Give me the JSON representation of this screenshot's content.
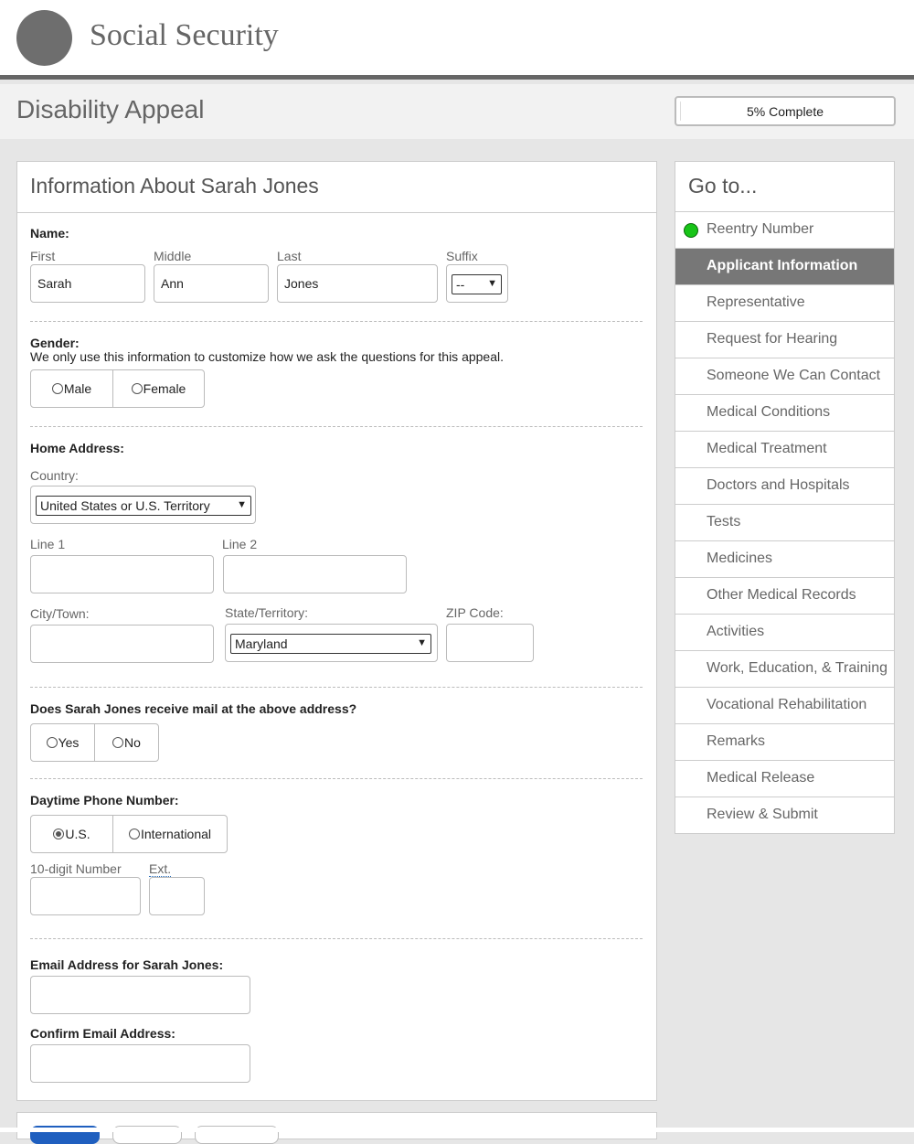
{
  "header": {
    "site_title": "Social Security"
  },
  "title_bar": {
    "page_title": "Disability Appeal",
    "progress_text": "5% Complete",
    "progress_percent": 5
  },
  "form": {
    "title": "Information About Sarah Jones",
    "name": {
      "label": "Name:",
      "first_label": "First",
      "first_value": "Sarah",
      "middle_label": "Middle",
      "middle_value": "Ann",
      "last_label": "Last",
      "last_value": "Jones",
      "suffix_label": "Suffix",
      "suffix_value": "--"
    },
    "gender": {
      "label": "Gender:",
      "help": "We only use this information to customize how we ask the questions for this appeal.",
      "options": [
        "Male",
        "Female"
      ]
    },
    "address": {
      "label": "Home Address:",
      "country_label": "Country:",
      "country_value": "United States or U.S. Territory",
      "line1_label": "Line 1",
      "line2_label": "Line 2",
      "city_label": "City/Town:",
      "state_label": "State/Territory:",
      "state_value": "Maryland",
      "zip_label": "ZIP Code:"
    },
    "mail": {
      "label": "Does Sarah Jones receive mail at the above address?",
      "options": [
        "Yes",
        "No"
      ]
    },
    "phone": {
      "label": "Daytime Phone Number:",
      "options": [
        "U.S.",
        "International"
      ],
      "selected": "U.S.",
      "number_label": "10-digit Number",
      "ext_label": "Ext."
    },
    "email": {
      "label": "Email Address for Sarah Jones:",
      "confirm_label": "Confirm Email Address:"
    }
  },
  "sidebar": {
    "title": "Go to...",
    "items": [
      {
        "label": "Reentry Number",
        "status": "complete"
      },
      {
        "label": "Applicant Information",
        "status": "active"
      },
      {
        "label": "Representative"
      },
      {
        "label": "Request for Hearing"
      },
      {
        "label": "Someone We Can Contact"
      },
      {
        "label": "Medical Conditions"
      },
      {
        "label": "Medical Treatment"
      },
      {
        "label": "Doctors and Hospitals"
      },
      {
        "label": "Tests"
      },
      {
        "label": "Medicines"
      },
      {
        "label": "Other Medical Records"
      },
      {
        "label": "Activities"
      },
      {
        "label": "Work, Education, & Training"
      },
      {
        "label": "Vocational Rehabilitation"
      },
      {
        "label": "Remarks"
      },
      {
        "label": "Medical Release"
      },
      {
        "label": "Review & Submit"
      }
    ]
  },
  "colors": {
    "status_complete": "#18c418",
    "nav_active_bg": "#777777",
    "primary_button": "#1f5fbf"
  }
}
